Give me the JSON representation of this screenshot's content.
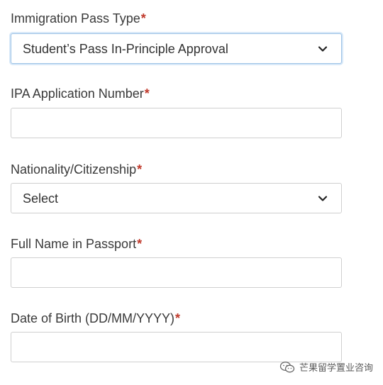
{
  "form": {
    "pass_type": {
      "label": "Immigration Pass Type",
      "required_mark": "*",
      "value": "Student’s Pass In-Principle Approval"
    },
    "ipa_number": {
      "label": "IPA Application Number",
      "required_mark": "*",
      "value": ""
    },
    "nationality": {
      "label": "Nationality/Citizenship",
      "required_mark": "*",
      "value": "Select"
    },
    "full_name": {
      "label": "Full Name in Passport",
      "required_mark": "*",
      "value": ""
    },
    "dob": {
      "label": "Date of Birth (DD/MM/YYYY)",
      "required_mark": "*",
      "value": ""
    }
  },
  "watermark": {
    "text": "芒果留学置业咨询",
    "icon": "wechat-icon"
  },
  "colors": {
    "required": "#c0392b",
    "focus_border": "#9ec3e6",
    "border": "#cfcfcf",
    "text": "#333333"
  }
}
